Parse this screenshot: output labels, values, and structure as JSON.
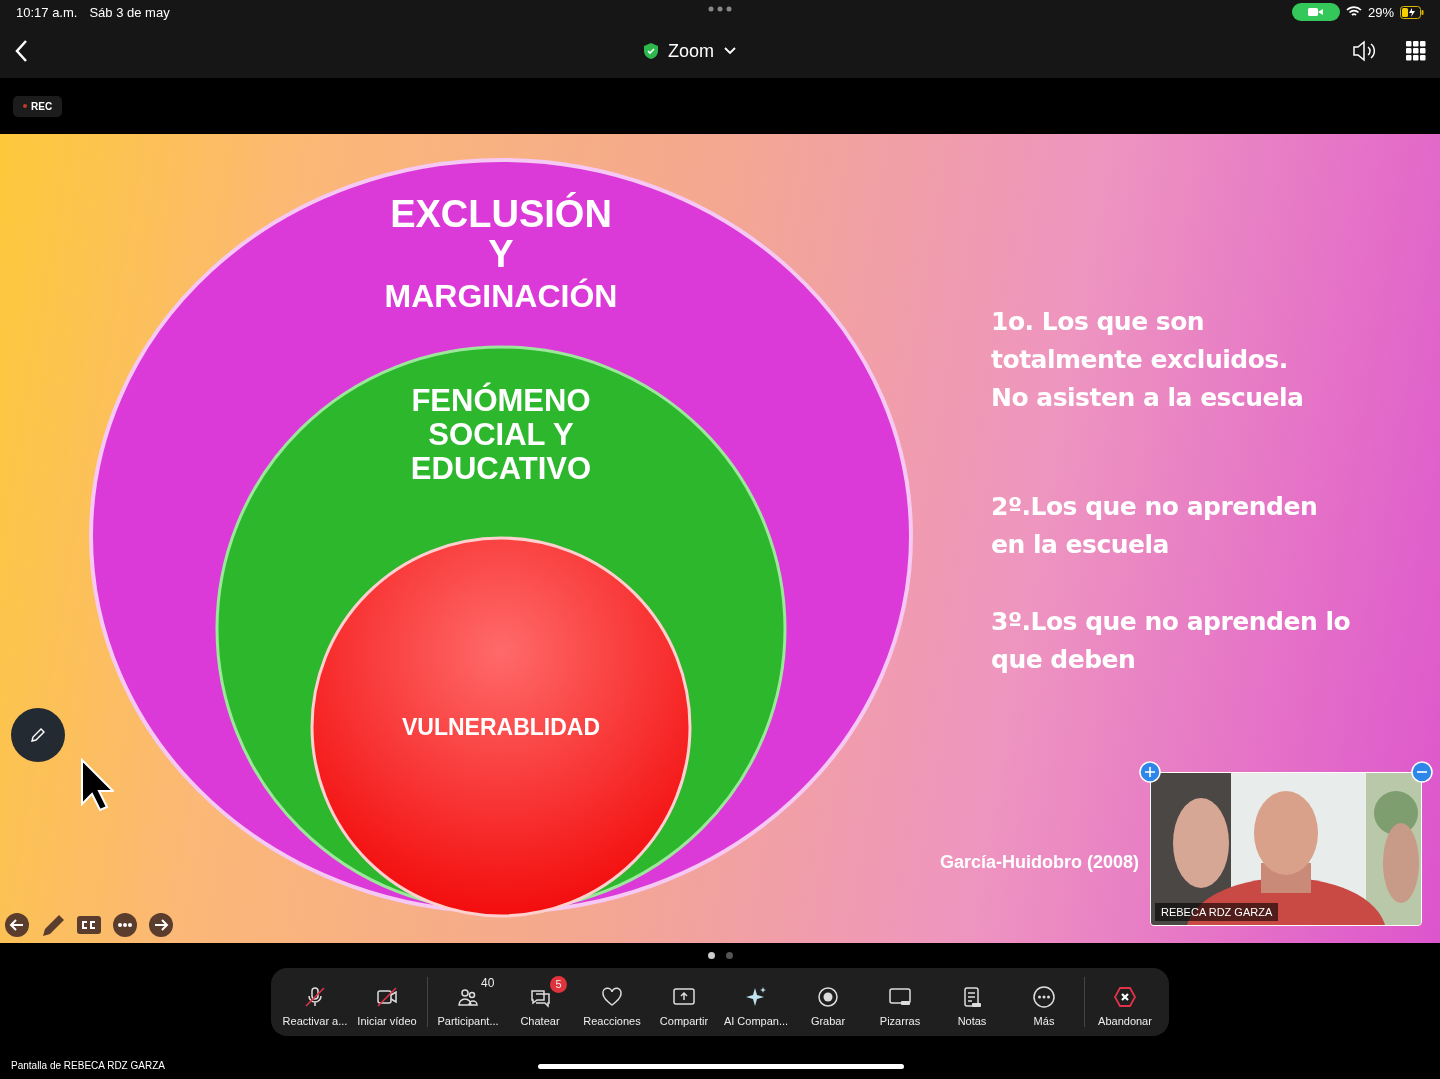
{
  "status_bar": {
    "time": "10:17 a.m.",
    "date": "Sáb 3 de may",
    "battery": "29%"
  },
  "nav": {
    "title": "Zoom"
  },
  "recording": {
    "label": "REC"
  },
  "slide": {
    "outer": [
      "EXCLUSIÓN",
      "Y",
      "MARGINACIÓN"
    ],
    "middle": [
      "FENÓMENO",
      "SOCIAL Y",
      "EDUCATIVO"
    ],
    "inner": "VULNERABLIDAD",
    "points": [
      [
        "1o. Los que son",
        "totalmente excluidos.",
        "No asisten a la escuela"
      ],
      [
        "2º.Los que no aprenden",
        "en la escuela"
      ],
      [
        "3º.Los que no aprenden lo",
        "que deben"
      ]
    ],
    "citation": "García-Huidobro (2008)"
  },
  "video": {
    "name": "REBECA RDZ GARZA",
    "kind": "picture"
  },
  "pager": [
    {
      "selected": true
    },
    {
      "selected": false
    }
  ],
  "toolbar": [
    {
      "kind": "mic",
      "label": "Reactivar a...",
      "off": true
    },
    {
      "kind": "video",
      "label": "Iniciar vídeo",
      "off": true
    },
    {
      "kind": "people",
      "label": "Participant...",
      "off": false,
      "count": "40"
    },
    {
      "kind": "chat",
      "label": "Chatear",
      "off": false,
      "badge": "5"
    },
    {
      "kind": "heart",
      "label": "Reacciones",
      "off": false
    },
    {
      "kind": "share",
      "label": "Compartir",
      "off": false
    },
    {
      "kind": "sparkle",
      "label": "AI Compan...",
      "off": false
    },
    {
      "kind": "record",
      "label": "Grabar",
      "off": false
    },
    {
      "kind": "board",
      "label": "Pizarras",
      "off": false
    },
    {
      "kind": "notes",
      "label": "Notas",
      "off": false
    },
    {
      "kind": "more",
      "label": "Más",
      "off": false
    },
    {
      "kind": "leave",
      "label": "Abandonar",
      "off": false
    }
  ],
  "footer": "Pantalla de REBECA RDZ GARZA"
}
